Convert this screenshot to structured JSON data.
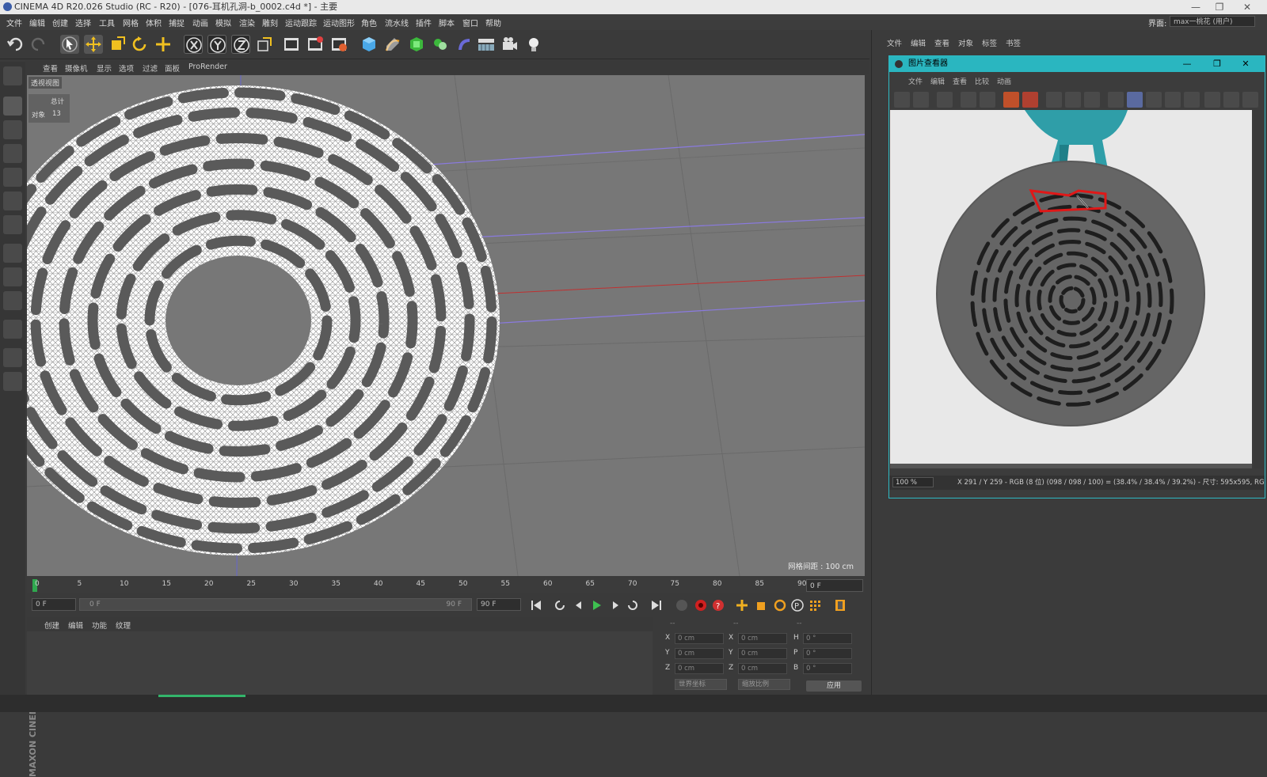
{
  "window": {
    "title": "CINEMA 4D R20.026 Studio (RC - R20) - [076-耳机孔洞-b_0002.c4d *] - 主要",
    "controls": [
      "—",
      "❐",
      "✕"
    ]
  },
  "menubar": {
    "items": [
      "文件",
      "编辑",
      "创建",
      "选择",
      "工具",
      "网格",
      "体积",
      "捕捉",
      "动画",
      "模拟",
      "渲染",
      "雕刻",
      "运动跟踪",
      "运动图形",
      "角色",
      "流水线",
      "插件",
      "脚本",
      "窗口",
      "帮助"
    ],
    "layout_label": "界面:",
    "layout_value": "max一桃花 (用户)"
  },
  "viewport": {
    "menu": [
      "查看",
      "摄像机",
      "显示",
      "选项",
      "过滤",
      "面板",
      "ProRender"
    ],
    "label": "透视视图",
    "stats_title": "总计",
    "stats_object_label": "对象",
    "stats_object_value": "13",
    "grid_spacing": "网格间距 : 100 cm"
  },
  "timeline": {
    "ticks": [
      "0",
      "5",
      "10",
      "15",
      "20",
      "25",
      "30",
      "35",
      "40",
      "45",
      "50",
      "55",
      "60",
      "65",
      "70",
      "75",
      "80",
      "85",
      "90"
    ],
    "current_frame": "0 F",
    "start_field": "0 F",
    "range_start": "0 F",
    "range_end": "90 F",
    "end_field": "90 F"
  },
  "material": {
    "menu": [
      "创建",
      "编辑",
      "功能",
      "纹理"
    ]
  },
  "coordinates": {
    "headers": [
      "--",
      "--",
      "--"
    ],
    "rows": [
      {
        "a": "X",
        "av": "0 cm",
        "b": "X",
        "bv": "0 cm",
        "c": "H",
        "cv": "0 °"
      },
      {
        "a": "Y",
        "av": "0 cm",
        "b": "Y",
        "bv": "0 cm",
        "c": "P",
        "cv": "0 °"
      },
      {
        "a": "Z",
        "av": "0 cm",
        "b": "Z",
        "bv": "0 cm",
        "c": "B",
        "cv": "0 °"
      }
    ],
    "coord_mode": "世界坐标",
    "scale_mode": "缩放比例",
    "apply": "应用"
  },
  "object_manager": {
    "menu": [
      "文件",
      "编辑",
      "查看",
      "对象",
      "标签",
      "书签"
    ]
  },
  "picture_viewer": {
    "title": "图片查看器",
    "menu": [
      "文件",
      "编辑",
      "查看",
      "比较",
      "动画"
    ],
    "zoom": "100 %",
    "readout": "X 291 / Y 259 - RGB (8 位) (098 / 098 / 100) = (38.4% / 38.4% / 39.2%) - 尺寸: 595x595, RGB"
  },
  "maxon": "MAXON CINEMA 4D"
}
